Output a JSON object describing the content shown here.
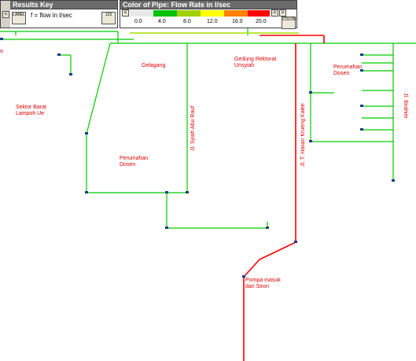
{
  "results_key": {
    "title": "Results Key",
    "text": "f = flow in l/sec",
    "label_button": "LABEL",
    "scale_button": "123",
    "nav_left": "<"
  },
  "color_key": {
    "title": "Color of Pipe: Flow Rate in l/sec",
    "ticks": [
      "0.0",
      "4.0",
      "8.0",
      "12.0",
      "16.0",
      "20.0"
    ],
    "color_button": "COLOR",
    "nav_prev": "<",
    "nav_next": ">",
    "colors": [
      "#e8e8e8",
      "#00c000",
      "#a0d000",
      "#ffff00",
      "#ff8000",
      "#ff0000"
    ]
  },
  "map_labels": {
    "gelagang": "Gelagang",
    "gedung": "Gedung Rektorat\nUnsyiah",
    "perumahan_right": "Perumahan\nDosen",
    "sektor_barat": "Sektor Barat\nLampoh Ue",
    "perumahan_center": "Perumahan\nDosen",
    "pompa": "Pompa masuk\ndari Siron",
    "jl_ibrahim": "Jl. Ibrahim",
    "jl_syiah": "Jl. Syiah Abu Rauf",
    "jl_hasan": "Jl. T. Hasan Krueng Kalee",
    "edge_left_top": "o"
  },
  "pipe_colors": {
    "low": "#00cc00",
    "mid": "#a6e000",
    "high": "#ff0000",
    "node": "#1a3a8a"
  }
}
